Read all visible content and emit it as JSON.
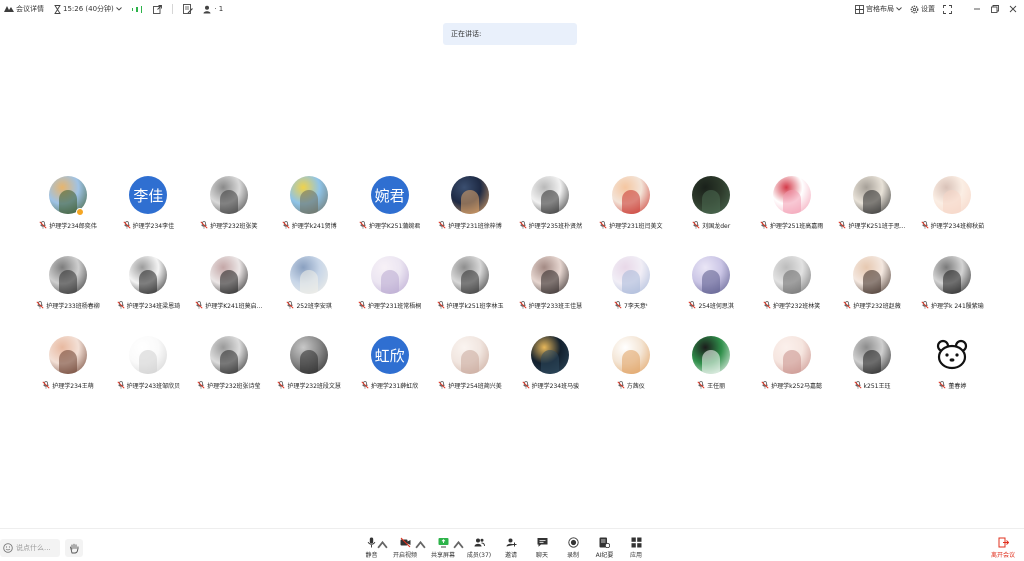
{
  "topbar": {
    "meeting_details": "会议详情",
    "timer": "15:26 (40分钟)",
    "participant_count_label": "· 1",
    "layout_label": "宫格布局",
    "settings_label": "设置"
  },
  "speaking": {
    "label": "正在讲话:"
  },
  "participants": [
    {
      "name": "护理学234郎奕伟",
      "avatar": {
        "kind": "image",
        "colors": [
          "#9fc3e6",
          "#3a5a2a",
          "#e8b56c"
        ]
      },
      "badge": true
    },
    {
      "name": "护理学234李佳",
      "avatar": {
        "kind": "text",
        "text": "李佳"
      }
    },
    {
      "name": "护理学232班张笑",
      "avatar": {
        "kind": "image",
        "colors": [
          "#d9d9d9",
          "#3b3b3b",
          "#8a8a8a"
        ]
      }
    },
    {
      "name": "护理学k241贺博",
      "avatar": {
        "kind": "image",
        "colors": [
          "#8fc4e8",
          "#6b6b5a",
          "#f0d24a"
        ]
      }
    },
    {
      "name": "护理学K251蒲婉君",
      "avatar": {
        "kind": "text",
        "text": "婉君"
      }
    },
    {
      "name": "护理学231班徐梓博",
      "avatar": {
        "kind": "image",
        "colors": [
          "#1e2a44",
          "#e3a76a",
          "#3b4f70"
        ]
      }
    },
    {
      "name": "护理学235班朴贤然",
      "avatar": {
        "kind": "image",
        "colors": [
          "#f1f1f1",
          "#2b2b2b",
          "#b9b9b9"
        ]
      }
    },
    {
      "name": "护理学231班闫美文",
      "avatar": {
        "kind": "image",
        "colors": [
          "#f3e4d8",
          "#c8332b",
          "#f5c6a0"
        ]
      }
    },
    {
      "name": "刘国龙der",
      "avatar": {
        "kind": "image",
        "colors": [
          "#2d3a2b",
          "#4d6b52",
          "#1a211b"
        ]
      }
    },
    {
      "name": "护理学251班高嘉雨",
      "avatar": {
        "kind": "image",
        "colors": [
          "#ffffff",
          "#f29bb0",
          "#d43b4a"
        ]
      }
    },
    {
      "name": "护理学K251班于思...",
      "avatar": {
        "kind": "image",
        "colors": [
          "#e8e2d8",
          "#2a2a2a",
          "#a6a098"
        ]
      }
    },
    {
      "name": "护理学234班柳秋茹",
      "avatar": {
        "kind": "image",
        "colors": [
          "#fbeee4",
          "#f6d5c6",
          "#d9c2b8"
        ]
      }
    },
    {
      "name": "护理学233班杨春柳",
      "avatar": {
        "kind": "image",
        "colors": [
          "#cfcfcf",
          "#2e2e2e",
          "#7d7d7d"
        ]
      }
    },
    {
      "name": "护理学234班梁恩琦",
      "avatar": {
        "kind": "image",
        "colors": [
          "#f4f4f4",
          "#1f1f1f",
          "#9c9c9c"
        ]
      }
    },
    {
      "name": "护理学K241班莫启...",
      "avatar": {
        "kind": "image",
        "colors": [
          "#ebe6e6",
          "#1c1c1c",
          "#c4a7a7"
        ]
      }
    },
    {
      "name": "252班李安琪",
      "avatar": {
        "kind": "image",
        "colors": [
          "#c8d6e8",
          "#f2f0e8",
          "#8aa0c0"
        ]
      }
    },
    {
      "name": "护理学231班常梧桐",
      "avatar": {
        "kind": "image",
        "colors": [
          "#ece6f2",
          "#b8a7d0",
          "#f7f1f7"
        ]
      }
    },
    {
      "name": "护理学k251班李林玉",
      "avatar": {
        "kind": "image",
        "colors": [
          "#d8d8d8",
          "#2f2f2f",
          "#8e8e8e"
        ]
      }
    },
    {
      "name": "护理学233班王佳慧",
      "avatar": {
        "kind": "image",
        "colors": [
          "#e6d6d0",
          "#2b2424",
          "#a38a84"
        ]
      }
    },
    {
      "name": "7李天意ᵗ",
      "avatar": {
        "kind": "image",
        "colors": [
          "#f1eef6",
          "#a8b8d8",
          "#e8d8e8"
        ]
      }
    },
    {
      "name": "254班何思淇",
      "avatar": {
        "kind": "image",
        "colors": [
          "#cbc6e6",
          "#5a5a8a",
          "#eae6f6"
        ]
      }
    },
    {
      "name": "护理学232班林笑",
      "avatar": {
        "kind": "image",
        "colors": [
          "#e2e2e2",
          "#6a6a6a",
          "#bcbcbc"
        ]
      }
    },
    {
      "name": "护理学232班赵薇",
      "avatar": {
        "kind": "image",
        "colors": [
          "#f4e8e0",
          "#3a2a22",
          "#e6c8b0"
        ]
      }
    },
    {
      "name": "护理学k 241殷紫瑜",
      "avatar": {
        "kind": "image",
        "colors": [
          "#d4d4d4",
          "#1e1e1e",
          "#7a7a7a"
        ]
      }
    },
    {
      "name": "护理学234王萌",
      "avatar": {
        "kind": "image",
        "colors": [
          "#f3e0d6",
          "#6a3e2e",
          "#e8b9a0"
        ]
      }
    },
    {
      "name": "护理学243班邹欣贝",
      "avatar": {
        "kind": "image",
        "colors": [
          "#fafafa",
          "#d0d0d0",
          "#ffffff"
        ]
      }
    },
    {
      "name": "护理学232班张诗莹",
      "avatar": {
        "kind": "image",
        "colors": [
          "#dcdcdc",
          "#262626",
          "#9a9a9a"
        ]
      }
    },
    {
      "name": "护理学232班段文慧",
      "avatar": {
        "kind": "image",
        "colors": [
          "#8a8a8a",
          "#2a2a2a",
          "#c8c8c8"
        ]
      }
    },
    {
      "name": "护理学231薛虹欣",
      "avatar": {
        "kind": "text",
        "text": "虹欣"
      }
    },
    {
      "name": "护理学254班蔺兴美",
      "avatar": {
        "kind": "image",
        "colors": [
          "#f1e6e0",
          "#c8a89a",
          "#faf4f0"
        ]
      }
    },
    {
      "name": "护理学234班马骏",
      "avatar": {
        "kind": "image",
        "colors": [
          "#12202e",
          "#2f4a5e",
          "#e8b85a"
        ]
      }
    },
    {
      "name": "方茜仪",
      "avatar": {
        "kind": "image",
        "colors": [
          "#f4e6d6",
          "#e0a060",
          "#ffffff"
        ]
      }
    },
    {
      "name": "王任丽",
      "avatar": {
        "kind": "image",
        "colors": [
          "#2f8f4a",
          "#ffffff",
          "#1c1c1c"
        ]
      }
    },
    {
      "name": "护理学k252马嘉懿",
      "avatar": {
        "kind": "image",
        "colors": [
          "#f6e6e0",
          "#c8908a",
          "#fbf0ec"
        ]
      }
    },
    {
      "name": "k251王珏",
      "avatar": {
        "kind": "image",
        "colors": [
          "#cfcfcf",
          "#1e1e1e",
          "#8c8c8c"
        ]
      }
    },
    {
      "name": "董春婷",
      "avatar": {
        "kind": "bear"
      }
    }
  ],
  "bottombar": {
    "chat_placeholder": "说点什么...",
    "tools": [
      {
        "label": "静音",
        "icon": "mic-icon",
        "caret": true
      },
      {
        "label": "开启视频",
        "icon": "video-off-icon",
        "caret": true
      },
      {
        "label": "共享屏幕",
        "icon": "share-screen-icon",
        "caret": true
      },
      {
        "label": "成员(37)",
        "icon": "members-icon",
        "caret": false
      },
      {
        "label": "邀请",
        "icon": "invite-icon",
        "caret": false
      },
      {
        "label": "聊天",
        "icon": "chat-icon",
        "caret": false
      },
      {
        "label": "录制",
        "icon": "record-icon",
        "caret": false
      },
      {
        "label": "AI纪要",
        "icon": "ai-notes-icon",
        "caret": false
      },
      {
        "label": "应用",
        "icon": "apps-icon",
        "caret": false
      }
    ],
    "leave_label": "离开会议"
  },
  "colors": {
    "accent_blue": "#2f6fd1",
    "speaking_bg": "#e9f0fb",
    "mute_red": "#e0301e",
    "signal_green": "#2db34a"
  }
}
